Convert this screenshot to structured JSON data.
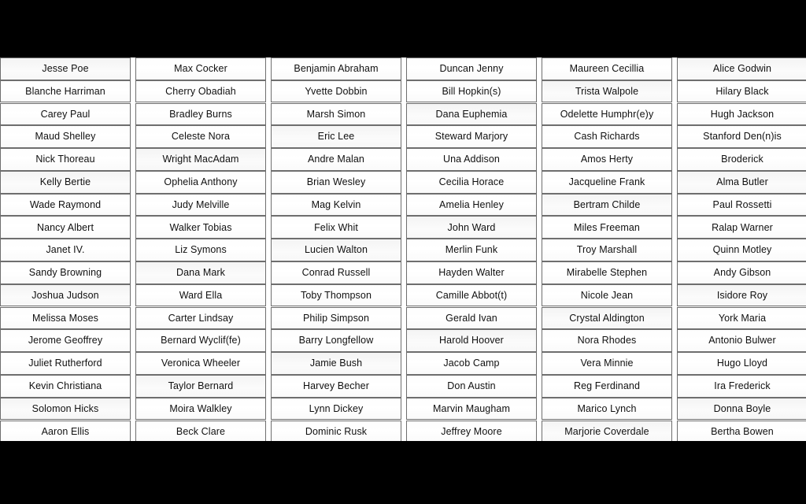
{
  "layout": {
    "columns": 6,
    "rows_visible": 17,
    "letterbox_color": "#000000",
    "cell_border_color": "#6e6e6e",
    "cell_background_color": "#ffffff",
    "text_color": "#101010"
  },
  "grid": {
    "columns": [
      {
        "index": 1,
        "cells": [
          "Jesse Poe",
          "Blanche Harriman",
          "Carey Paul",
          "Maud Shelley",
          "Nick Thoreau",
          "Kelly Bertie",
          "Wade Raymond",
          "Nancy Albert",
          "Janet IV.",
          "Sandy Browning",
          "Joshua Judson",
          "Melissa Moses",
          "Jerome Geoffrey",
          "Juliet Rutherford",
          "Kevin Christiana",
          "Solomon Hicks",
          "Aaron Ellis"
        ]
      },
      {
        "index": 2,
        "cells": [
          "Max Cocker",
          "Cherry Obadiah",
          "Bradley Burns",
          "Celeste Nora",
          "Wright MacAdam",
          "Ophelia Anthony",
          "Judy Melville",
          "Walker Tobias",
          "Liz Symons",
          "Dana Mark",
          "Ward Ella",
          "Carter Lindsay",
          "Bernard Wyclif(fe)",
          "Veronica Wheeler",
          "Taylor Bernard",
          "Moira Walkley",
          "Beck Clare"
        ]
      },
      {
        "index": 3,
        "cells": [
          "Benjamin Abraham",
          "Yvette Dobbin",
          "Marsh Simon",
          "Eric Lee",
          "Andre Malan",
          "Brian Wesley",
          "Mag Kelvin",
          "Felix Whit",
          "Lucien Walton",
          "Conrad Russell",
          "Toby Thompson",
          "Philip Simpson",
          "Barry Longfellow",
          "Jamie Bush",
          "Harvey Becher",
          "Lynn Dickey",
          "Dominic Rusk"
        ]
      },
      {
        "index": 4,
        "cells": [
          "Duncan Jenny",
          "Bill Hopkin(s)",
          "Dana Euphemia",
          "Steward Marjory",
          "Una Addison",
          "Cecilia Horace",
          "Amelia Henley",
          "John Ward",
          "Merlin Funk",
          "Hayden Walter",
          "Camille Abbot(t)",
          "Gerald Ivan",
          "Harold Hoover",
          "Jacob Camp",
          "Don Austin",
          "Marvin Maugham",
          "Jeffrey Moore"
        ]
      },
      {
        "index": 5,
        "cells": [
          "Maureen Cecillia",
          "Trista Walpole",
          "Odelette Humphr(e)y",
          "Cash Richards",
          "Amos Herty",
          "Jacqueline Frank",
          "Bertram Childe",
          "Miles Freeman",
          "Troy Marshall",
          "Mirabelle Stephen",
          "Nicole Jean",
          "Crystal Aldington",
          "Nora Rhodes",
          "Vera Minnie",
          "Reg Ferdinand",
          "Marico Lynch",
          "Marjorie Coverdale"
        ]
      },
      {
        "index": 6,
        "cells": [
          "Alice Godwin",
          "Hilary Black",
          "Hugh Jackson",
          "Stanford Den(n)is",
          "Broderick",
          "Alma Butler",
          "Paul Rossetti",
          "Ralap Warner",
          "Quinn Motley",
          "Andy Gibson",
          "Isidore Roy",
          "York Maria",
          "Antonio Bulwer",
          "Hugo Lloyd",
          "Ira Frederick",
          "Donna Boyle",
          "Bertha Bowen"
        ]
      }
    ]
  }
}
